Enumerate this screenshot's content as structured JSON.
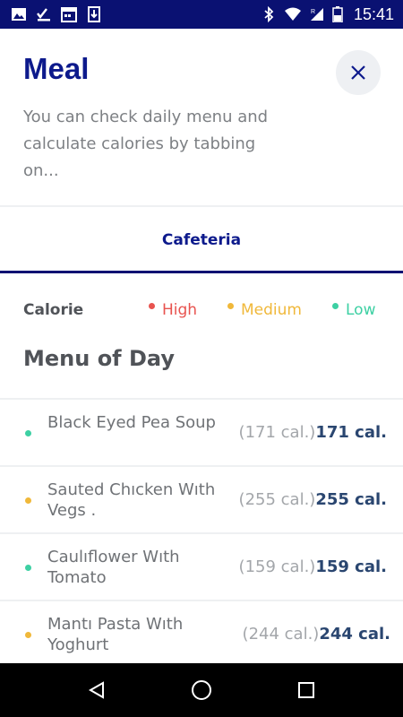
{
  "status_bar": {
    "time": "15:41",
    "left_icons": [
      "image-icon",
      "check-download-icon",
      "calendar-icon",
      "download-icon"
    ],
    "right_icons": [
      "bluetooth-icon",
      "wifi-icon",
      "signal-icon",
      "battery-icon"
    ]
  },
  "header": {
    "title": "Meal",
    "subtitle": "You can check daily menu and calculate calories by tabbing on...",
    "close_icon": "close-icon"
  },
  "tabs": [
    {
      "label": "Cafeteria",
      "active": true
    }
  ],
  "legend": {
    "title": "Calorie",
    "levels": [
      {
        "label": "High",
        "color": "#e8534f"
      },
      {
        "label": "Medium",
        "color": "#f0b83a"
      },
      {
        "label": "Low",
        "color": "#3dd0a3"
      }
    ]
  },
  "menu": {
    "title": "Menu of Day",
    "items": [
      {
        "name": "Black Eyed Pea Soup",
        "paren_cal": "(171 cal.)",
        "cal": "171 cal.",
        "level": "Low",
        "dot_color": "#3dd0a3"
      },
      {
        "name": "Sauted Chıcken Wıth Vegs .",
        "paren_cal": "(255 cal.)",
        "cal": "255 cal.",
        "level": "Medium",
        "dot_color": "#f0b83a"
      },
      {
        "name": "Caulıflower Wıth Tomato",
        "paren_cal": "(159 cal.)",
        "cal": "159 cal.",
        "level": "Low",
        "dot_color": "#3dd0a3"
      },
      {
        "name": "Mantı Pasta Wıth Yoghurt",
        "paren_cal": "(244 cal.)",
        "cal": "244 cal.",
        "level": "Medium",
        "dot_color": "#f0b83a"
      }
    ]
  },
  "nav_bar": {
    "buttons": [
      "back-icon",
      "home-icon",
      "recents-icon"
    ]
  },
  "colors": {
    "brand_navy": "#0a1172",
    "title_navy": "#0d1a8c",
    "calorie_text": "#2a4670"
  }
}
